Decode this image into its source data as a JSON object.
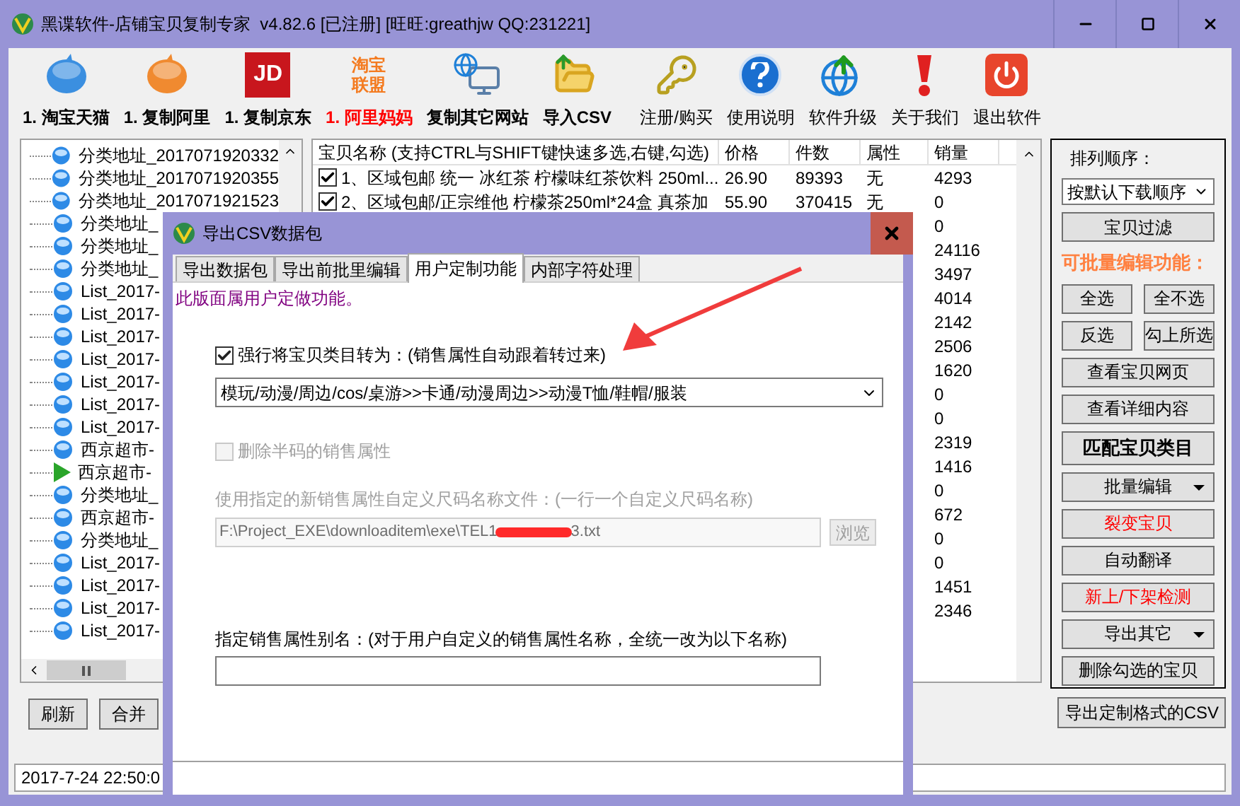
{
  "window": {
    "title": "黑谍软件-店铺宝贝复制专家  v4.82.6 [已注册] [旺旺:greathjw QQ:231221]"
  },
  "toolbar": [
    {
      "label": "1. 淘宝天猫",
      "highlight": false
    },
    {
      "label": "1. 复制阿里",
      "highlight": false
    },
    {
      "label": "1. 复制京东",
      "logo_lines": [
        "JD"
      ],
      "highlight": false
    },
    {
      "label": "1. 阿里妈妈",
      "logo_lines": [
        "淘宝",
        "联盟"
      ],
      "highlight": true
    },
    {
      "label": "复制其它网站",
      "highlight": false
    },
    {
      "label": "导入CSV",
      "highlight": false
    },
    {
      "label": "注册/购买",
      "highlight": false
    },
    {
      "label": "使用说明",
      "highlight": false
    },
    {
      "label": "软件升级",
      "highlight": false
    },
    {
      "label": "关于我们",
      "highlight": false
    },
    {
      "label": "退出软件",
      "highlight": false
    }
  ],
  "tree": {
    "items": [
      {
        "label": "分类地址_2017071920332",
        "kind": "globe"
      },
      {
        "label": "分类地址_2017071920355",
        "kind": "globe"
      },
      {
        "label": "分类地址_2017071921523",
        "kind": "globe"
      },
      {
        "label": "分类地址_",
        "kind": "globe"
      },
      {
        "label": "分类地址_",
        "kind": "globe"
      },
      {
        "label": "分类地址_",
        "kind": "globe"
      },
      {
        "label": "List_2017-",
        "kind": "globe"
      },
      {
        "label": "List_2017-",
        "kind": "globe"
      },
      {
        "label": "List_2017-",
        "kind": "globe"
      },
      {
        "label": "List_2017-",
        "kind": "globe"
      },
      {
        "label": "List_2017-",
        "kind": "globe"
      },
      {
        "label": "List_2017-",
        "kind": "globe"
      },
      {
        "label": "List_2017-",
        "kind": "globe"
      },
      {
        "label": "西京超市-",
        "kind": "globe"
      },
      {
        "label": "西京超市-",
        "kind": "play"
      },
      {
        "label": "分类地址_",
        "kind": "globe"
      },
      {
        "label": "西京超市-",
        "kind": "globe"
      },
      {
        "label": "分类地址_",
        "kind": "globe"
      },
      {
        "label": "List_2017-",
        "kind": "globe"
      },
      {
        "label": "List_2017-",
        "kind": "globe"
      },
      {
        "label": "List_2017-",
        "kind": "globe"
      },
      {
        "label": "List_2017-",
        "kind": "globe"
      }
    ]
  },
  "table": {
    "columns": [
      "宝贝名称 (支持CTRL与SHIFT键快速多选,右键,勾选)",
      "价格",
      "件数",
      "属性",
      "销量"
    ],
    "rows": [
      {
        "checked": true,
        "name": "1、区域包邮 统一 冰红茶 柠檬味红茶饮料 250ml...",
        "price": "26.90",
        "count": "89393",
        "attr": "无",
        "sales": "4293"
      },
      {
        "checked": true,
        "name": "2、区域包邮/正宗维他 柠檬茶250ml*24盒 真茶加",
        "price": "55.90",
        "count": "370415",
        "attr": "无",
        "sales": "0"
      },
      {
        "sales": "0"
      },
      {
        "sales": "24116"
      },
      {
        "sales": "3497"
      },
      {
        "sales": "4014"
      },
      {
        "sales": "2142"
      },
      {
        "sales": "2506"
      },
      {
        "sales": "1620"
      },
      {
        "sales": "0"
      },
      {
        "sales": "0"
      },
      {
        "sales": "2319"
      },
      {
        "sales": "1416"
      },
      {
        "sales": "0"
      },
      {
        "sales": "672"
      },
      {
        "sales": "0"
      },
      {
        "sales": "0"
      },
      {
        "sales": "1451"
      },
      {
        "sales": "2346"
      }
    ]
  },
  "side_panel": {
    "sort_label": "排列顺序：",
    "sort_value": "按默认下载顺序",
    "rows": [
      {
        "kind": "buttons",
        "items": [
          {
            "label": "宝贝过滤",
            "kind": "normal",
            "dropdown": false
          }
        ]
      },
      {
        "kind": "heading",
        "label": "可批量编辑功能："
      },
      {
        "kind": "buttons",
        "items": [
          {
            "label": "全选",
            "kind": "normal",
            "dropdown": false
          },
          {
            "label": "全不选",
            "kind": "normal",
            "dropdown": false
          }
        ]
      },
      {
        "kind": "buttons",
        "items": [
          {
            "label": "反选",
            "kind": "normal",
            "dropdown": false
          },
          {
            "label": "勾上所选",
            "kind": "normal",
            "dropdown": false
          }
        ]
      },
      {
        "kind": "buttons",
        "items": [
          {
            "label": "查看宝贝网页",
            "kind": "normal",
            "dropdown": false
          }
        ]
      },
      {
        "kind": "buttons",
        "items": [
          {
            "label": "查看详细内容",
            "kind": "normal",
            "dropdown": false
          }
        ]
      },
      {
        "kind": "buttons",
        "items": [
          {
            "label": "匹配宝贝类目",
            "kind": "bold",
            "dropdown": false
          }
        ]
      },
      {
        "kind": "buttons",
        "items": [
          {
            "label": "批量编辑",
            "kind": "normal",
            "dropdown": true
          }
        ]
      },
      {
        "kind": "buttons",
        "items": [
          {
            "label": "裂变宝贝",
            "kind": "red",
            "dropdown": false
          }
        ]
      },
      {
        "kind": "buttons",
        "items": [
          {
            "label": "自动翻译",
            "kind": "normal",
            "dropdown": false
          }
        ]
      },
      {
        "kind": "buttons",
        "items": [
          {
            "label": "新上/下架检测",
            "kind": "red",
            "dropdown": false
          }
        ]
      },
      {
        "kind": "buttons",
        "items": [
          {
            "label": "导出其它",
            "kind": "normal",
            "dropdown": true
          }
        ]
      },
      {
        "kind": "buttons",
        "items": [
          {
            "label": "删除勾选的宝贝",
            "kind": "normal",
            "dropdown": false
          }
        ]
      }
    ]
  },
  "export_button": "导出定制格式的CSV",
  "bottom_buttons": [
    "刷新",
    "合并"
  ],
  "status": "2017-7-24 22:50:0",
  "dialog": {
    "title": "导出CSV数据包",
    "tabs": [
      {
        "label": "导出数据包",
        "selected": false
      },
      {
        "label": "导出前批里编辑",
        "selected": false
      },
      {
        "label": "用户定制功能",
        "selected": true
      },
      {
        "label": "内部字符处理",
        "selected": false
      }
    ],
    "note": "此版面属用户定做功能。",
    "convert_option": {
      "label": "强行将宝贝类目转为：(销售属性自动跟着转过来)",
      "checked": true,
      "disabled": false
    },
    "category_value": "模玩/动漫/周边/cos/桌游>>卡通/动漫周边>>动漫T恤/鞋帽/服装",
    "half_size_option": {
      "label": "删除半码的销售属性",
      "checked": false,
      "disabled": true
    },
    "file_label": "使用指定的新销售属性自定义尺码名称文件：(一行一个自定义尺码名称)",
    "file_path_start": "F:\\Project_EXE\\downloaditem\\exe\\TEL1",
    "file_path_end": "3.txt",
    "browse_button": "浏览",
    "alias_label": "指定销售属性别名：(对于用户自定义的销售属性名称，全统一改为以下名称)"
  }
}
